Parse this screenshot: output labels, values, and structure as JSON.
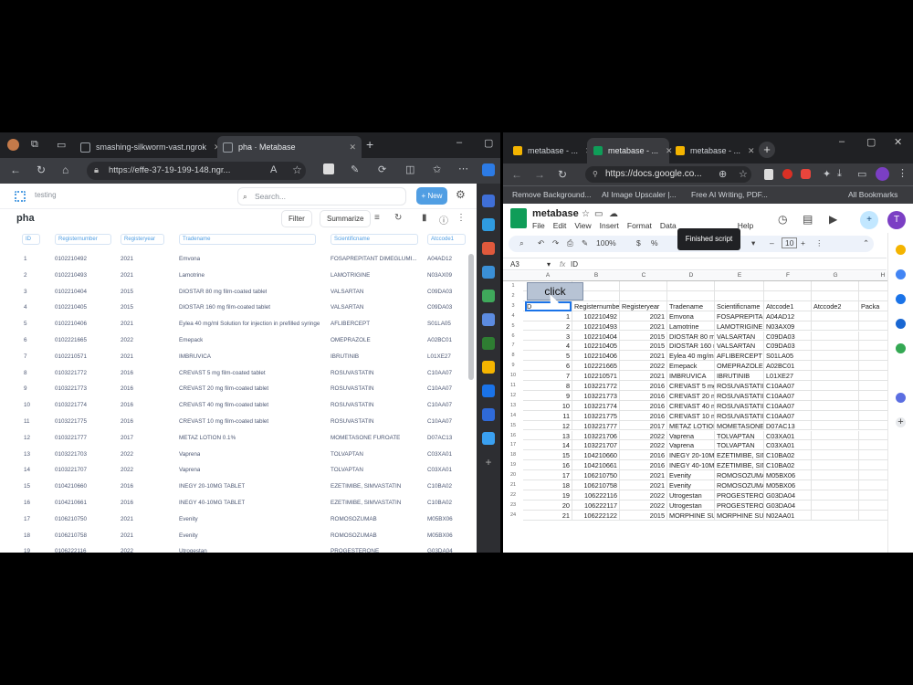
{
  "left_browser": {
    "tabs": [
      {
        "title": "smashing-silkworm-vast.ngrok"
      },
      {
        "title": "pha · Metabase"
      }
    ],
    "url": "https://effe-37-19-199-148.ngr..."
  },
  "metabase": {
    "breadcrumb": "testing",
    "search_placeholder": "Search...",
    "new_label": "New",
    "question_title": "pha",
    "filter_label": "Filter",
    "summarize_label": "Summarize",
    "columns": [
      "ID",
      "Registernumber",
      "Registeryear",
      "Tradename",
      "Scientificname",
      "Atccode1"
    ],
    "rows": [
      [
        "1",
        "0102210492",
        "2021",
        "Emvona",
        "FOSAPREPITANT DIMEGLUMI...",
        "A04AD12"
      ],
      [
        "2",
        "0102210493",
        "2021",
        "Lamotrine",
        "LAMOTRIGINE",
        "N03AX09"
      ],
      [
        "3",
        "0102210404",
        "2015",
        "DIOSTAR 80 mg film-coated tablet",
        "VALSARTAN",
        "C09DA03"
      ],
      [
        "4",
        "0102210405",
        "2015",
        "DIOSTAR 160 mg film-coated tablet",
        "VALSARTAN",
        "C09DA03"
      ],
      [
        "5",
        "0102210406",
        "2021",
        "Eylea 40 mg/ml Solution for injection in prefilled syringe",
        "AFLIBERCEPT",
        "S01LA05"
      ],
      [
        "6",
        "0102221665",
        "2022",
        "Emepack",
        "OMEPRAZOLE",
        "A02BC01"
      ],
      [
        "7",
        "0102210571",
        "2021",
        "IMBRUVICA",
        "IBRUTINIB",
        "L01XE27"
      ],
      [
        "8",
        "0103221772",
        "2016",
        "CREVAST 5 mg film-coated tablet",
        "ROSUVASTATIN",
        "C10AA07"
      ],
      [
        "9",
        "0103221773",
        "2016",
        "CREVAST 20 mg film-coated tablet",
        "ROSUVASTATIN",
        "C10AA07"
      ],
      [
        "10",
        "0103221774",
        "2016",
        "CREVAST 40 mg film-coated tablet",
        "ROSUVASTATIN",
        "C10AA07"
      ],
      [
        "11",
        "0103221775",
        "2016",
        "CREVAST 10 mg film-coated tablet",
        "ROSUVASTATIN",
        "C10AA07"
      ],
      [
        "12",
        "0103221777",
        "2017",
        "METAZ LOTION 0.1%",
        "MOMETASONE FUROATE",
        "D07AC13"
      ],
      [
        "13",
        "0103221703",
        "2022",
        "Vaprena",
        "TOLVAPTAN",
        "C03XA01"
      ],
      [
        "14",
        "0103221707",
        "2022",
        "Vaprena",
        "TOLVAPTAN",
        "C03XA01"
      ],
      [
        "15",
        "0104210660",
        "2016",
        "INEGY 20-10MG TABLET",
        "EZETIMIBE, SIMVASTATIN",
        "C10BA02"
      ],
      [
        "16",
        "0104210661",
        "2016",
        "INEGY 40-10MG TABLET",
        "EZETIMIBE, SIMVASTATIN",
        "C10BA02"
      ],
      [
        "17",
        "0106210750",
        "2021",
        "Evenity",
        "ROMOSOZUMAB",
        "M05BX06"
      ],
      [
        "18",
        "0106210758",
        "2021",
        "Evenity",
        "ROMOSOZUMAB",
        "M05BX06"
      ],
      [
        "19",
        "0106222116",
        "2022",
        "Utrogestan",
        "PROGESTERONE",
        "G03DA04"
      ]
    ]
  },
  "right_browser": {
    "tabs": [
      {
        "title": "metabase - ..."
      },
      {
        "title": "metabase - ..."
      },
      {
        "title": "metabase - ..."
      }
    ],
    "url": "https://docs.google.co...",
    "bookmarks": [
      "Remove Background...",
      "AI Image Upscaler |...",
      "Free AI Writing, PDF...",
      "All Bookmarks"
    ]
  },
  "sheets": {
    "doc_title": "metabase",
    "menu": [
      "File",
      "Edit",
      "View",
      "Insert",
      "Format",
      "Data",
      "Help"
    ],
    "tooltip": "Finished script",
    "zoom": "100%",
    "font_size": "10",
    "cell_ref": "A3",
    "formula": "ID",
    "col_letters": [
      "A",
      "B",
      "C",
      "D",
      "E",
      "F",
      "G",
      "H"
    ],
    "button_text": "click",
    "header_row": [
      "ID",
      "Registernumber",
      "Registeryear",
      "Tradename",
      "Scientificname",
      "Atccode1",
      "Atccode2",
      "Packa"
    ],
    "row_numbers": [
      "1",
      "2",
      "3",
      "4",
      "5",
      "6",
      "7",
      "8",
      "9",
      "10",
      "11",
      "12",
      "13",
      "14",
      "15",
      "16",
      "17",
      "18",
      "19",
      "20",
      "21",
      "22",
      "23",
      "24"
    ],
    "rows": [
      [
        "1",
        "102210492",
        "2021",
        "Emvona",
        "FOSAPREPITAN",
        "A04AD12"
      ],
      [
        "2",
        "102210493",
        "2021",
        "Lamotrine",
        "LAMOTRIGINE",
        "N03AX09"
      ],
      [
        "3",
        "102210404",
        "2015",
        "DIOSTAR 80 mg",
        "VALSARTAN",
        "C09DA03"
      ],
      [
        "4",
        "102210405",
        "2015",
        "DIOSTAR 160 m",
        "VALSARTAN",
        "C09DA03"
      ],
      [
        "5",
        "102210406",
        "2021",
        "Eylea 40 mg/ml",
        "AFLIBERCEPT",
        "S01LA05"
      ],
      [
        "6",
        "102221665",
        "2022",
        "Emepack",
        "OMEPRAZOLE",
        "A02BC01"
      ],
      [
        "7",
        "102210571",
        "2021",
        "IMBRUVICA",
        "IBRUTINIB",
        "L01XE27"
      ],
      [
        "8",
        "103221772",
        "2016",
        "CREVAST 5 mg",
        "ROSUVASTATIN",
        "C10AA07"
      ],
      [
        "9",
        "103221773",
        "2016",
        "CREVAST 20 m",
        "ROSUVASTATIN",
        "C10AA07"
      ],
      [
        "10",
        "103221774",
        "2016",
        "CREVAST 40 m",
        "ROSUVASTATIN",
        "C10AA07"
      ],
      [
        "11",
        "103221775",
        "2016",
        "CREVAST 10 m",
        "ROSUVASTATIN",
        "C10AA07"
      ],
      [
        "12",
        "103221777",
        "2017",
        "METAZ LOTION",
        "MOMETASONE",
        "D07AC13"
      ],
      [
        "13",
        "103221706",
        "2022",
        "Vaprena",
        "TOLVAPTAN",
        "C03XA01"
      ],
      [
        "14",
        "103221707",
        "2022",
        "Vaprena",
        "TOLVAPTAN",
        "C03XA01"
      ],
      [
        "15",
        "104210660",
        "2016",
        "INEGY 20-10MG",
        "EZETIMIBE, SIM",
        "C10BA02"
      ],
      [
        "16",
        "104210661",
        "2016",
        "INEGY 40-10MG",
        "EZETIMIBE, SIM",
        "C10BA02"
      ],
      [
        "17",
        "106210750",
        "2021",
        "Evenity",
        "ROMOSOZUMAB",
        "M05BX06"
      ],
      [
        "18",
        "106210758",
        "2021",
        "Evenity",
        "ROMOSOZUMAB",
        "M05BX06"
      ],
      [
        "19",
        "106222116",
        "2022",
        "Utrogestan",
        "PROGESTERONE",
        "G03DA04"
      ],
      [
        "20",
        "106222117",
        "2022",
        "Utrogestan",
        "PROGESTERONE",
        "G03DA04"
      ],
      [
        "21",
        "106222122",
        "2015",
        "MORPHINE SUL",
        "MORPHINE SUL",
        "N02AA01"
      ],
      [
        "22",
        "106222122",
        "2015",
        "MORPHINE SUL",
        "MORPHINE SUL",
        "N02AA01"
      ],
      [
        "23",
        "106222123",
        "2016",
        "GLYCOPYRRON",
        "GLYCOPYRRON",
        "A03AB02"
      ],
      [
        "24",
        "106222123",
        "2016",
        "GLYCOPYRRON",
        "GLYCOPYRRON",
        "A03AB02"
      ]
    ]
  },
  "colors": {
    "metabase_blue": "#509ee3",
    "sheets_green": "#0f9d58",
    "selection_blue": "#1a73e8"
  }
}
